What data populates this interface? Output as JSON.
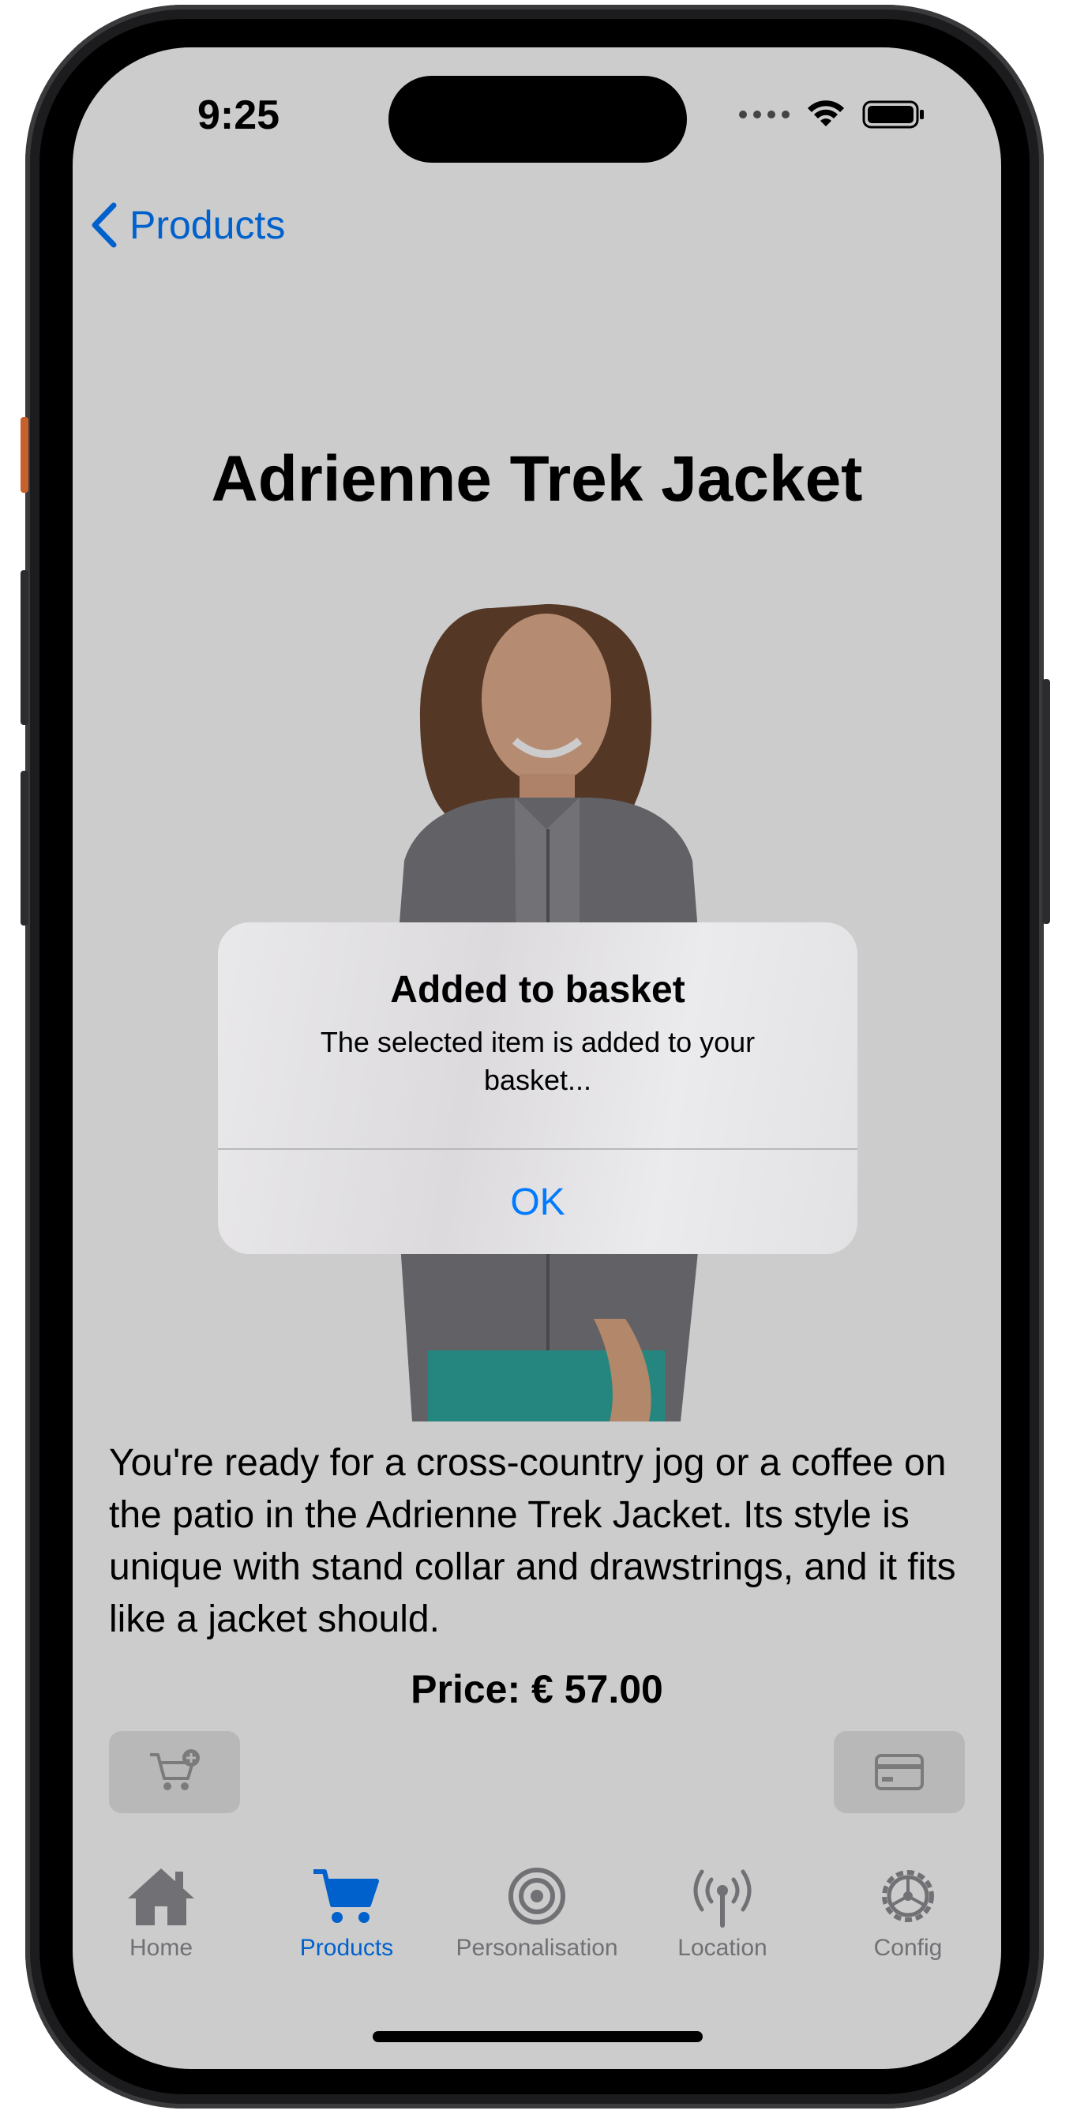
{
  "status_bar": {
    "time": "9:25"
  },
  "nav": {
    "back_label": "Products"
  },
  "product": {
    "title": "Adrienne Trek Jacket",
    "description": "You're ready for a cross-country jog or a coffee on the patio in the Adrienne Trek Jacket. Its style is unique with stand collar and drawstrings, and it fits like a jacket should.",
    "price": "Price: € 57.00"
  },
  "actions": {
    "add_to_cart_icon": "cart-plus-icon",
    "pay_icon": "credit-card-icon"
  },
  "alert": {
    "title": "Added to basket",
    "message": "The selected item is added to your basket...",
    "ok_label": "OK"
  },
  "tabs": [
    {
      "label": "Home",
      "icon": "house-icon"
    },
    {
      "label": "Products",
      "icon": "cart-icon",
      "active": true
    },
    {
      "label": "Personalisation",
      "icon": "target-icon"
    },
    {
      "label": "Location",
      "icon": "antenna-icon"
    },
    {
      "label": "Config",
      "icon": "gear-icon"
    }
  ],
  "colors": {
    "accent": "#007aff",
    "inactive": "#8e8e93",
    "dim_overlay": "rgba(0,0,0,0.2)"
  }
}
